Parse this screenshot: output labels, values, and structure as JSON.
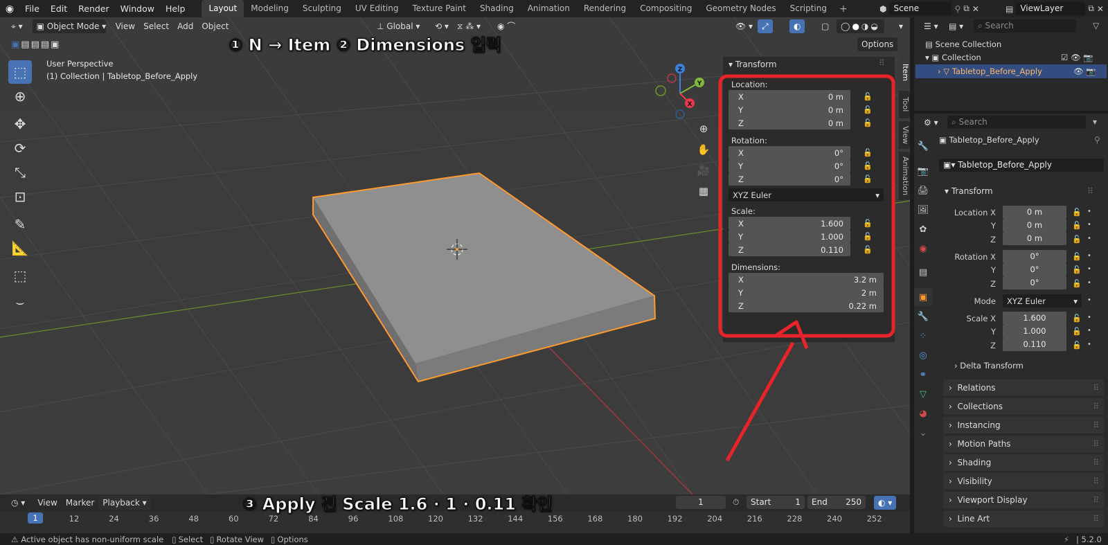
{
  "menu": [
    "File",
    "Edit",
    "Render",
    "Window",
    "Help"
  ],
  "workspaces": [
    "Layout",
    "Modeling",
    "Sculpting",
    "UV Editing",
    "Texture Paint",
    "Shading",
    "Animation",
    "Rendering",
    "Compositing",
    "Geometry Nodes",
    "Scripting"
  ],
  "active_workspace": "Layout",
  "scene_name": "Scene",
  "view_layer": "ViewLayer",
  "viewport": {
    "mode": "Object Mode",
    "menus": [
      "View",
      "Select",
      "Add",
      "Object"
    ],
    "orientation": "Global",
    "options_label": "Options",
    "perspective": "User Perspective",
    "collection_info": "(1) Collection | Tabletop_Before_Apply"
  },
  "gizmo": {
    "z": "Z",
    "y": "Y",
    "x": "X"
  },
  "annotations": {
    "top": "① N → Item  ② Dimensions 입력",
    "bottom": "③ Apply 전 Scale 1.6 · 1 · 0.11 확인"
  },
  "npanel": {
    "title": "Transform",
    "location_label": "Location:",
    "location": [
      {
        "axis": "X",
        "value": "0 m"
      },
      {
        "axis": "Y",
        "value": "0 m"
      },
      {
        "axis": "Z",
        "value": "0 m"
      }
    ],
    "rotation_label": "Rotation:",
    "rotation": [
      {
        "axis": "X",
        "value": "0°"
      },
      {
        "axis": "Y",
        "value": "0°"
      },
      {
        "axis": "Z",
        "value": "0°"
      }
    ],
    "rotation_mode": "XYZ Euler",
    "scale_label": "Scale:",
    "scale": [
      {
        "axis": "X",
        "value": "1.600"
      },
      {
        "axis": "Y",
        "value": "1.000"
      },
      {
        "axis": "Z",
        "value": "0.110"
      }
    ],
    "dimensions_label": "Dimensions:",
    "dimensions": [
      {
        "axis": "X",
        "value": "3.2 m"
      },
      {
        "axis": "Y",
        "value": "2 m"
      },
      {
        "axis": "Z",
        "value": "0.22 m"
      }
    ],
    "tabs": [
      "Item",
      "Tool",
      "View",
      "Animation"
    ]
  },
  "outliner": {
    "search_placeholder": "Search",
    "scene_collection": "Scene Collection",
    "collection": "Collection",
    "object": "Tabletop_Before_Apply"
  },
  "properties": {
    "search_placeholder": "Search",
    "object_name": "Tabletop_Before_Apply",
    "data_name": "Tabletop_Before_Apply",
    "transform_label": "Transform",
    "location_x_label": "Location X",
    "rotation_x_label": "Rotation X",
    "scale_x_label": "Scale X",
    "y_label": "Y",
    "z_label": "Z",
    "mode_label": "Mode",
    "location": [
      "0 m",
      "0 m",
      "0 m"
    ],
    "rotation": [
      "0°",
      "0°",
      "0°"
    ],
    "mode": "XYZ Euler",
    "scale": [
      "1.600",
      "1.000",
      "0.110"
    ],
    "delta_transform": "Delta Transform",
    "panels": [
      "Relations",
      "Collections",
      "Instancing",
      "Motion Paths",
      "Shading",
      "Visibility",
      "Viewport Display",
      "Line Art"
    ]
  },
  "timeline": {
    "menus": [
      "View",
      "Marker",
      "Playback"
    ],
    "current_frame": "1",
    "start_label": "Start",
    "start": "1",
    "end_label": "End",
    "end": "250",
    "frames": [
      "1",
      "12",
      "24",
      "36",
      "48",
      "60",
      "72",
      "84",
      "96",
      "108",
      "120",
      "132",
      "144",
      "156",
      "168",
      "180",
      "192",
      "204",
      "216",
      "228",
      "240",
      "252"
    ]
  },
  "status": {
    "warning": "Active object has non-uniform scale",
    "select": "Select",
    "rotate": "Rotate View",
    "options": "Options",
    "version": "5.2.0"
  },
  "colors": {
    "accent": "#4772b3",
    "selection": "#ff9a2e",
    "highlight_box": "#e8232a",
    "x_axis": "#e8394d",
    "y_axis": "#7fb83a",
    "z_axis": "#3c82e0"
  }
}
